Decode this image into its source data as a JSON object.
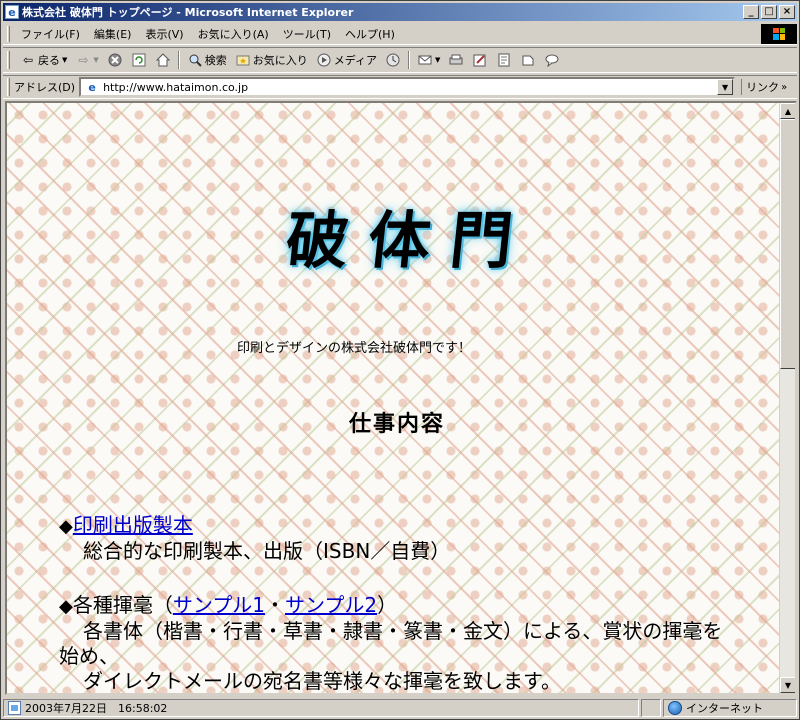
{
  "window": {
    "title": "株式会社 破体門 トップページ - Microsoft Internet Explorer",
    "app_icon": "e",
    "controls": [
      "_",
      "□",
      "×"
    ]
  },
  "menu": [
    "ファイル(F)",
    "編集(E)",
    "表示(V)",
    "お気に入り(A)",
    "ツール(T)",
    "ヘルプ(H)"
  ],
  "toolbar": {
    "back": "戻る",
    "search": "検索",
    "favorites": "お気に入り",
    "media": "メディア"
  },
  "address": {
    "label": "アドレス(D)",
    "url": "http://www.hataimon.co.jp",
    "links": "リンク"
  },
  "page": {
    "logo": [
      "破",
      "体",
      "門"
    ],
    "tagline": "印刷とデザインの株式会社破体門です！",
    "section_title": "仕事内容",
    "items": [
      {
        "bullet": "◆",
        "link": "印刷出版製本",
        "desc": "総合的な印刷製本、出版（ISBN／自費）"
      },
      {
        "bullet": "◆",
        "prefix": "各種揮毫（",
        "link1": "サンプル1",
        "mid": "・",
        "link2": "サンプル2",
        "suffix": "）",
        "desc1": "各書体（楷書・行書・草書・隷書・篆書・金文）による、賞状の揮毫を",
        "desc2": "始め、",
        "desc3": "ダイレクトメールの宛名書等様々な揮毫を致します。"
      }
    ]
  },
  "status": {
    "text": "2003年7月22日　16:58:02",
    "zone": "インターネット"
  }
}
